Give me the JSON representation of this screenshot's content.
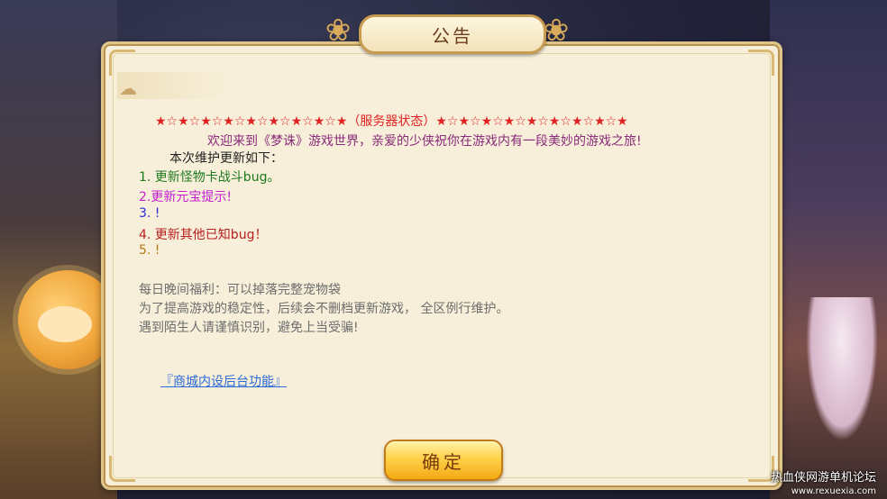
{
  "dialog": {
    "title": "公告",
    "status_line": "★☆★☆★☆★☆★☆★☆★☆★☆★（服务器状态）★☆★☆★☆★☆★☆★☆★☆★☆★",
    "welcome": "欢迎来到《梦诛》游戏世界，亲爱的少侠祝你在游戏内有一段美妙的游戏之旅!",
    "update_title": "本次维护更新如下：",
    "items": [
      "1. 更新怪物卡战斗bug。",
      "2.更新元宝提示!",
      "3. !",
      "4. 更新其他已知bug！",
      "5. !"
    ],
    "notices": [
      "每日晚间福利：可以掉落完整宠物袋",
      "为了提高游戏的稳定性，后续会不删档更新游戏， 全区例行维护。",
      "遇到陌生人请谨慎识别，避免上当受骗!"
    ],
    "link_text": "『商城内设后台功能』",
    "ok_button": "确定"
  },
  "watermark": {
    "text": "热血侠网游单机论坛",
    "url": "www.rexuexia.com"
  },
  "icons": {
    "lotus": "lotus-ornament-icon",
    "cloud": "cloud-ornament-icon"
  },
  "colors": {
    "status": "#e02222",
    "welcome": "#8a2a7a",
    "item1": "#1d7a1d",
    "item2": "#c61ccf",
    "item3": "#2b2be0",
    "item4": "#b82020",
    "item5": "#b07c18",
    "notice": "#6d6d6d",
    "link": "#2b6ad8",
    "button": "#ffd24a"
  }
}
